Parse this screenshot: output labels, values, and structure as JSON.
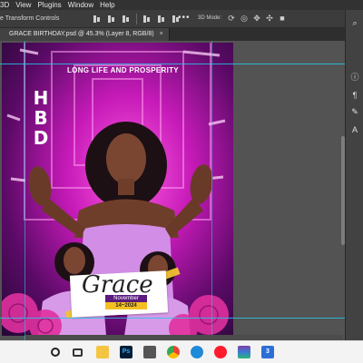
{
  "menubar": {
    "items": [
      "3D",
      "View",
      "Plugins",
      "Window",
      "Help"
    ]
  },
  "options_bar": {
    "transform_controls_label": "e Transform Controls",
    "more_label": "•••",
    "mode_3d_label": "3D Mode:"
  },
  "tab": {
    "title": "GRACE BIRTHDAY.psd @ 45.3% (Layer 8, RGB/8)",
    "close_label": "×"
  },
  "poster": {
    "headline": "LONG LIFE AND PROSPERITY",
    "hbd_letters": [
      "H",
      "B",
      "D"
    ],
    "name": "Grace",
    "month": "November",
    "date": "14~2024"
  },
  "taskbar": {
    "icons": [
      {
        "name": "start-search-icon"
      },
      {
        "name": "task-view-icon"
      },
      {
        "name": "file-explorer-icon"
      },
      {
        "name": "photoshop-icon",
        "label": "Ps"
      },
      {
        "name": "printer-icon"
      },
      {
        "name": "chrome-icon"
      },
      {
        "name": "edge-icon"
      },
      {
        "name": "opera-icon"
      },
      {
        "name": "winrar-icon"
      },
      {
        "name": "3-icon",
        "label": "3"
      }
    ]
  },
  "colors": {
    "guide": "#25c7e8",
    "accent_purple": "#5a1a7e",
    "accent_yellow": "#f4c021",
    "pink": "#ff5ee1"
  }
}
